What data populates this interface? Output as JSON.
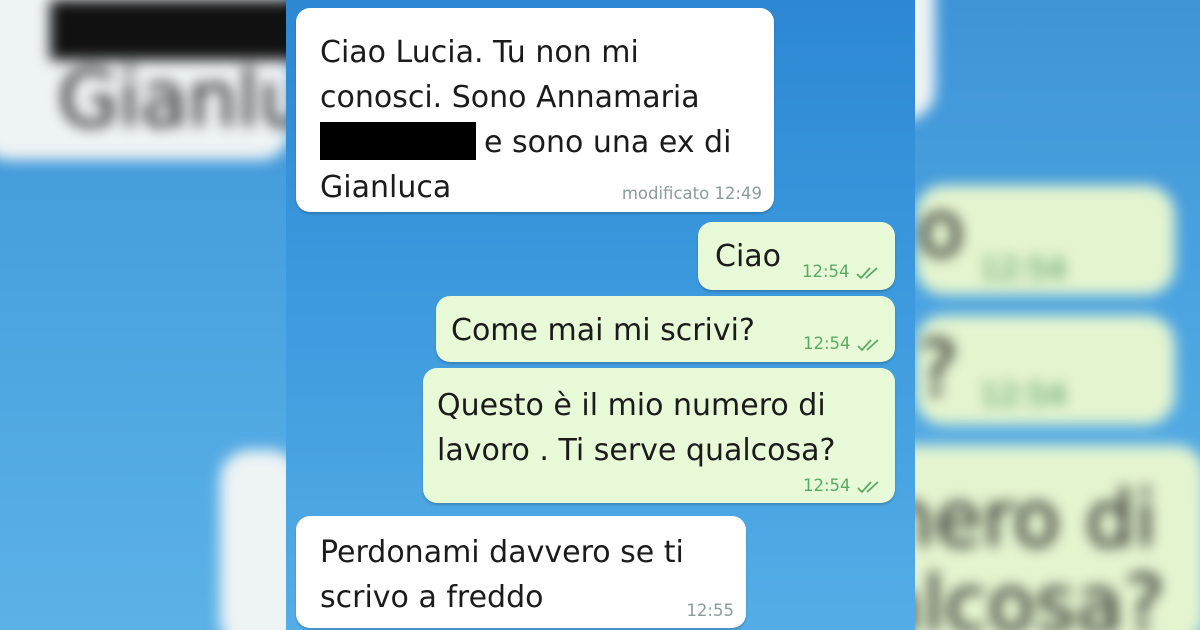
{
  "backdrop": {
    "left_name": "Gianluc",
    "right_ciao_fragment": "o",
    "right_scrivi_fragment": "?",
    "right_numero_fragment": "nero di",
    "right_qualcosa_fragment": "alcosa?",
    "right_time": "12:54"
  },
  "messages": [
    {
      "direction": "incoming",
      "lines": [
        "Ciao Lucia. Tu non mi",
        "conosci. Sono Annamaria",
        "e sono una ex di",
        "Gianluca"
      ],
      "meta": "modificato 12:49",
      "redacted_name": true
    },
    {
      "direction": "outgoing",
      "lines": [
        "Ciao"
      ],
      "time": "12:54",
      "status": "read"
    },
    {
      "direction": "outgoing",
      "lines": [
        "Come mai mi scrivi?"
      ],
      "time": "12:54",
      "status": "read"
    },
    {
      "direction": "outgoing",
      "lines": [
        "Questo è il mio numero di",
        "lavoro . Ti serve qualcosa?"
      ],
      "time": "12:54",
      "status": "read"
    },
    {
      "direction": "incoming",
      "lines": [
        "Perdonami davvero se ti",
        "scrivo a freddo"
      ],
      "meta": "12:55"
    }
  ],
  "colors": {
    "incoming_bubble": "#ffffff",
    "outgoing_bubble": "#e7f9d6",
    "read_check": "#5aa866",
    "redaction": "#000000"
  },
  "icons": {
    "read_receipt": "double-check-icon"
  }
}
